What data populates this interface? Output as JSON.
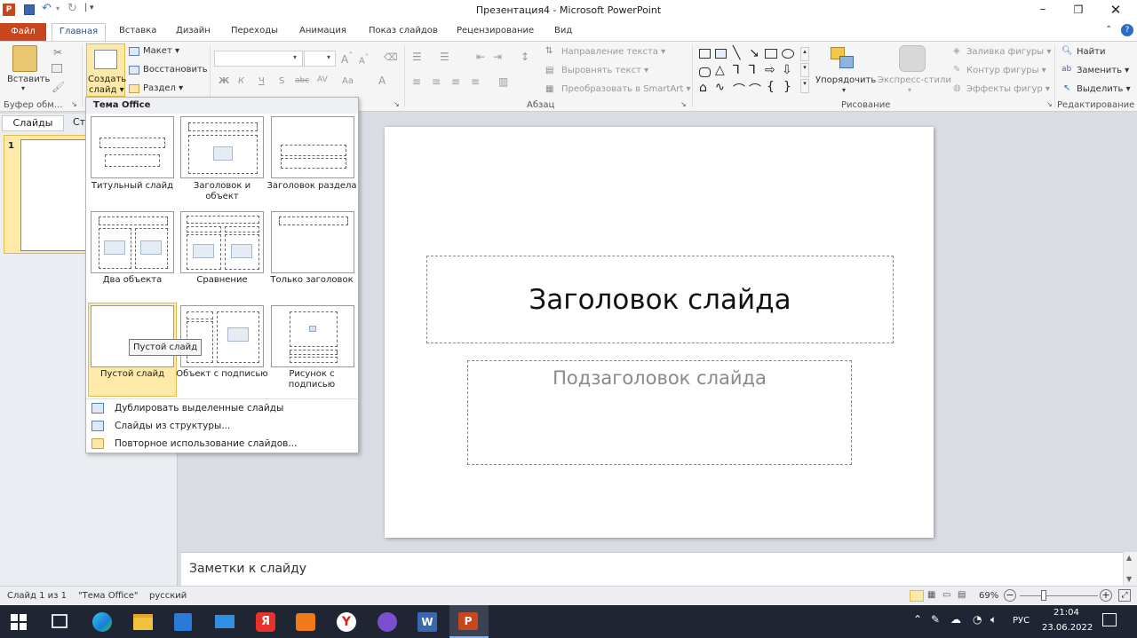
{
  "window": {
    "title": "Презентация4 - Microsoft PowerPoint",
    "quick_access": "▾"
  },
  "tabs": [
    {
      "label": "Файл"
    },
    {
      "label": "Главная"
    },
    {
      "label": "Вставка"
    },
    {
      "label": "Дизайн"
    },
    {
      "label": "Переходы"
    },
    {
      "label": "Анимация"
    },
    {
      "label": "Показ слайдов"
    },
    {
      "label": "Рецензирование"
    },
    {
      "label": "Вид"
    }
  ],
  "ribbon": {
    "paste": "Вставить",
    "new_slide_line1": "Создать",
    "new_slide_line2": "слайд ▾",
    "layout": "Макет ▾",
    "reset": "Восстановить",
    "section": "Раздел ▾",
    "text_direction": "Направление текста ▾",
    "align_text": "Выровнять текст ▾",
    "smartart": "Преобразовать в SmartArt ▾",
    "arrange": "Упорядочить",
    "quick_styles": "Экспресс-стили",
    "shape_fill": "Заливка фигуры ▾",
    "shape_outline": "Контур фигуры ▾",
    "shape_effects": "Эффекты фигур ▾",
    "find": "Найти",
    "replace": "Заменить ▾",
    "select": "Выделить ▾",
    "groups": {
      "clipboard": "Буфер обм...",
      "paragraph": "Абзац",
      "drawing": "Рисование",
      "editing": "Редактирование"
    }
  },
  "left_panel": {
    "tab_slides": "Слайды",
    "tab_outline": "Ст",
    "slide_number": "1"
  },
  "layout_gallery": {
    "header": "Тема Office",
    "layouts": [
      {
        "label": "Титульный слайд"
      },
      {
        "label": "Заголовок и объект"
      },
      {
        "label": "Заголовок раздела"
      },
      {
        "label": "Два объекта"
      },
      {
        "label": "Сравнение"
      },
      {
        "label": "Только заголовок"
      },
      {
        "label": "Пустой слайд"
      },
      {
        "label": "Объект с подписью"
      },
      {
        "label": "Рисунок с подписью"
      }
    ],
    "tooltip": "Пустой слайд",
    "menu": [
      {
        "label": "Дублировать выделенные слайды"
      },
      {
        "label": "Слайды из структуры..."
      },
      {
        "label": "Повторное использование слайдов..."
      }
    ]
  },
  "slide": {
    "title": "Заголовок слайда",
    "subtitle": "Подзаголовок слайда"
  },
  "notes": {
    "placeholder": "Заметки к слайду"
  },
  "status": {
    "slide_info": "Слайд 1 из 1",
    "theme": "\"Тема Office\"",
    "language": "русский",
    "zoom": "69%"
  },
  "tray": {
    "lang": "РУС",
    "time": "21:04",
    "date": "23.06.2022"
  },
  "colors": {
    "file_tab": "#c8461e",
    "accent": "#2b4d8c",
    "hover": "#fde9a8",
    "taskbar": "#1f2532"
  }
}
